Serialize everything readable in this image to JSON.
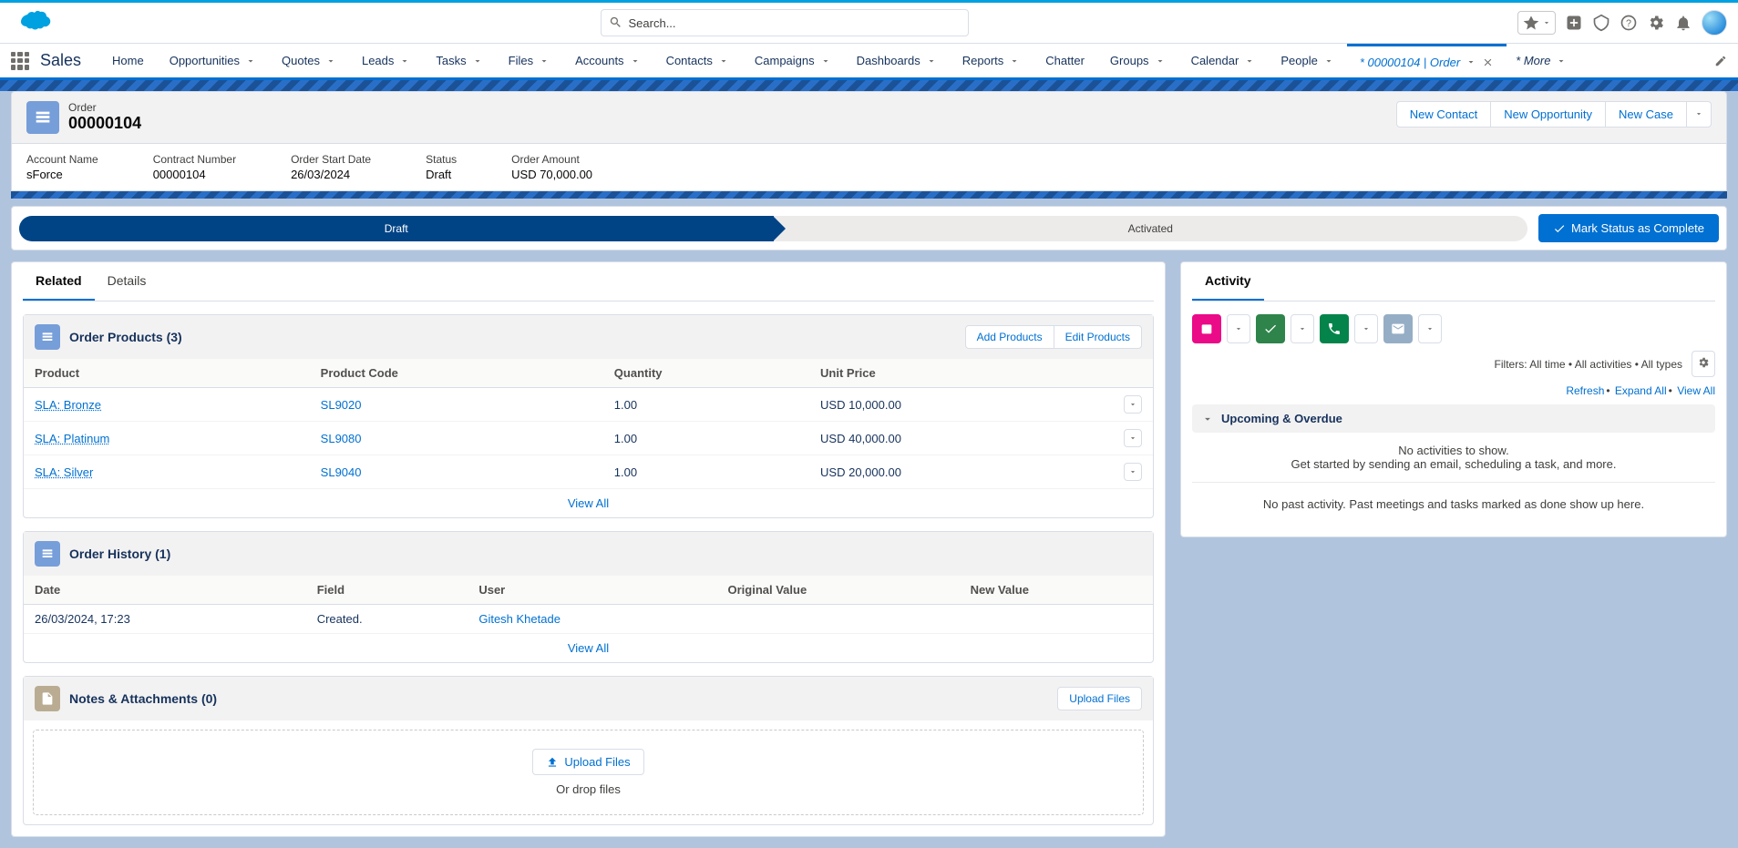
{
  "search": {
    "placeholder": "Search..."
  },
  "app": {
    "name": "Sales"
  },
  "nav": {
    "items": [
      "Home",
      "Opportunities",
      "Quotes",
      "Leads",
      "Tasks",
      "Files",
      "Accounts",
      "Contacts",
      "Campaigns",
      "Dashboards",
      "Reports",
      "Chatter",
      "Groups",
      "Calendar",
      "People"
    ],
    "activeTab": "* 00000104 | Order",
    "more": "* More"
  },
  "record": {
    "objectLabel": "Order",
    "title": "00000104",
    "actions": {
      "newContact": "New Contact",
      "newOpportunity": "New Opportunity",
      "newCase": "New Case"
    }
  },
  "highlights": {
    "account": {
      "label": "Account Name",
      "value": "sForce"
    },
    "contract": {
      "label": "Contract Number",
      "value": "00000104"
    },
    "start": {
      "label": "Order Start Date",
      "value": "26/03/2024"
    },
    "status": {
      "label": "Status",
      "value": "Draft"
    },
    "amount": {
      "label": "Order Amount",
      "value": "USD 70,000.00"
    }
  },
  "path": {
    "stages": [
      "Draft",
      "Activated"
    ],
    "markComplete": "Mark Status as Complete"
  },
  "mainTabs": {
    "related": "Related",
    "details": "Details"
  },
  "orderProducts": {
    "title": "Order Products (3)",
    "actions": {
      "add": "Add Products",
      "edit": "Edit Products"
    },
    "columns": {
      "product": "Product",
      "code": "Product Code",
      "qty": "Quantity",
      "price": "Unit Price"
    },
    "rows": [
      {
        "product": "SLA: Bronze",
        "code": "SL9020",
        "qty": "1.00",
        "price": "USD 10,000.00"
      },
      {
        "product": "SLA: Platinum",
        "code": "SL9080",
        "qty": "1.00",
        "price": "USD 40,000.00"
      },
      {
        "product": "SLA: Silver",
        "code": "SL9040",
        "qty": "1.00",
        "price": "USD 20,000.00"
      }
    ],
    "viewAll": "View All"
  },
  "orderHistory": {
    "title": "Order History (1)",
    "columns": {
      "date": "Date",
      "field": "Field",
      "user": "User",
      "orig": "Original Value",
      "new": "New Value"
    },
    "rows": [
      {
        "date": "26/03/2024, 17:23",
        "field": "Created.",
        "user": "Gitesh Khetade",
        "orig": "",
        "new": ""
      }
    ],
    "viewAll": "View All"
  },
  "notes": {
    "title": "Notes & Attachments (0)",
    "uploadAction": "Upload Files",
    "uploadBtn": "Upload Files",
    "drop": "Or drop files"
  },
  "activity": {
    "tab": "Activity",
    "filters": "Filters: All time • All activities • All types",
    "refresh": "Refresh",
    "expand": "Expand All",
    "viewAll": "View All",
    "upcoming": "Upcoming & Overdue",
    "noActivities": "No activities to show.",
    "getStarted": "Get started by sending an email, scheduling a task, and more.",
    "pastNone": "No past activity. Past meetings and tasks marked as done show up here."
  }
}
